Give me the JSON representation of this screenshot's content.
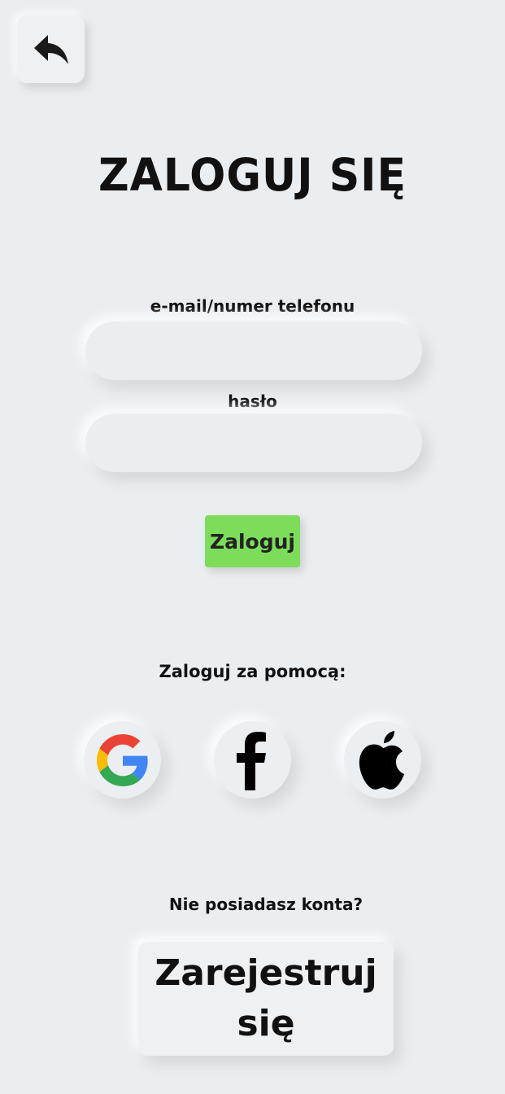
{
  "header": {
    "back_icon": "reply-arrow-icon",
    "title": "ZALOGUJ SIĘ"
  },
  "form": {
    "email_label": "e-mail/numer telefonu",
    "email_value": "",
    "password_label": "hasło",
    "password_value": "",
    "submit_label": "Zaloguj",
    "submit_color": "#7ddd5b"
  },
  "social": {
    "heading": "Zaloguj za pomocą:",
    "providers": [
      {
        "name": "Google",
        "icon": "google-icon"
      },
      {
        "name": "Facebook",
        "icon": "facebook-icon"
      },
      {
        "name": "Apple",
        "icon": "apple-icon"
      }
    ]
  },
  "register": {
    "question": "Nie posiadasz konta?",
    "button_label": "Zarejestruj się"
  }
}
